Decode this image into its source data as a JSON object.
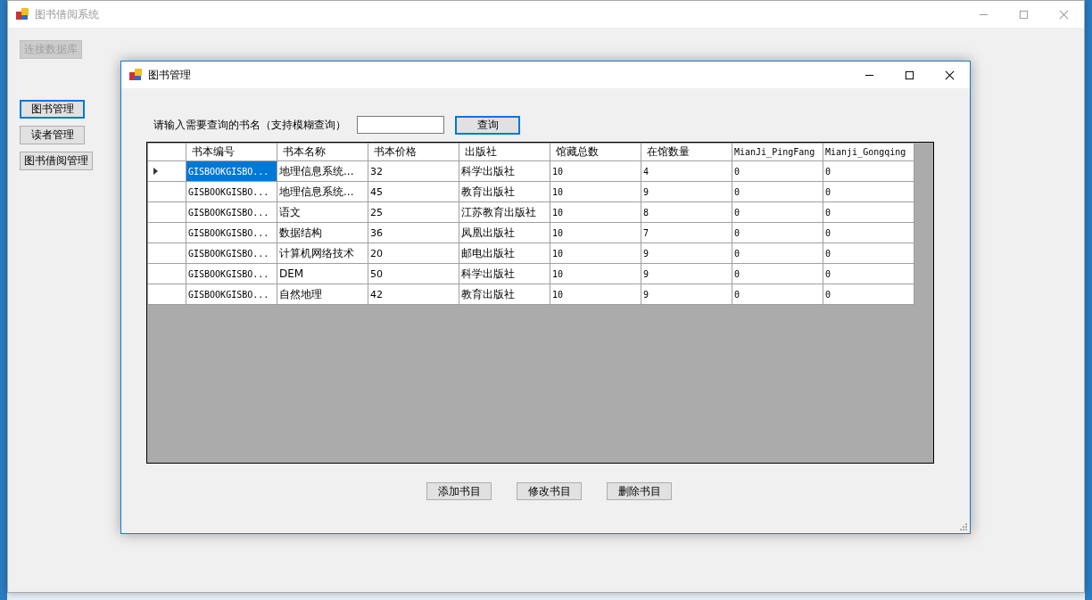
{
  "main_window": {
    "title": "图书借阅系统",
    "connect_button": {
      "label": "连接数据库",
      "disabled": true
    },
    "nav_buttons": [
      {
        "label": "图书管理",
        "selected": true
      },
      {
        "label": "读者管理",
        "selected": false
      },
      {
        "label": "图书借阅管理",
        "selected": false
      }
    ]
  },
  "child_window": {
    "title": "图书管理",
    "search": {
      "label": "请输入需要查询的书名（支持模糊查询）",
      "button": "查询"
    },
    "table": {
      "columns": [
        "书本编号",
        "书本名称",
        "书本价格",
        "出版社",
        "馆藏总数",
        "在馆数量",
        "MianJi_PingFang",
        "Mianji_Gongqing"
      ],
      "rows": [
        {
          "selected": true,
          "cells": [
            "GISBOOKGISBO...",
            "地理信息系统...",
            "32",
            "科学出版社",
            "10",
            "4",
            "0",
            "0"
          ]
        },
        {
          "selected": false,
          "cells": [
            "GISBOOKGISBO...",
            "地理信息系统...",
            "45",
            "教育出版社",
            "10",
            "9",
            "0",
            "0"
          ]
        },
        {
          "selected": false,
          "cells": [
            "GISBOOKGISBO...",
            "语文",
            "25",
            "江苏教育出版社",
            "10",
            "8",
            "0",
            "0"
          ]
        },
        {
          "selected": false,
          "cells": [
            "GISBOOKGISBO...",
            "数据结构",
            "36",
            "凤凰出版社",
            "10",
            "7",
            "0",
            "0"
          ]
        },
        {
          "selected": false,
          "cells": [
            "GISBOOKGISBO...",
            "计算机网络技术",
            "20",
            "邮电出版社",
            "10",
            "9",
            "0",
            "0"
          ]
        },
        {
          "selected": false,
          "cells": [
            "GISBOOKGISBO...",
            "DEM",
            "50",
            "科学出版社",
            "10",
            "9",
            "0",
            "0"
          ]
        },
        {
          "selected": false,
          "cells": [
            "GISBOOKGISBO...",
            "自然地理",
            "42",
            "教育出版社",
            "10",
            "9",
            "0",
            "0"
          ]
        }
      ]
    },
    "buttons": [
      "添加书目",
      "修改书目",
      "删除书目"
    ]
  }
}
